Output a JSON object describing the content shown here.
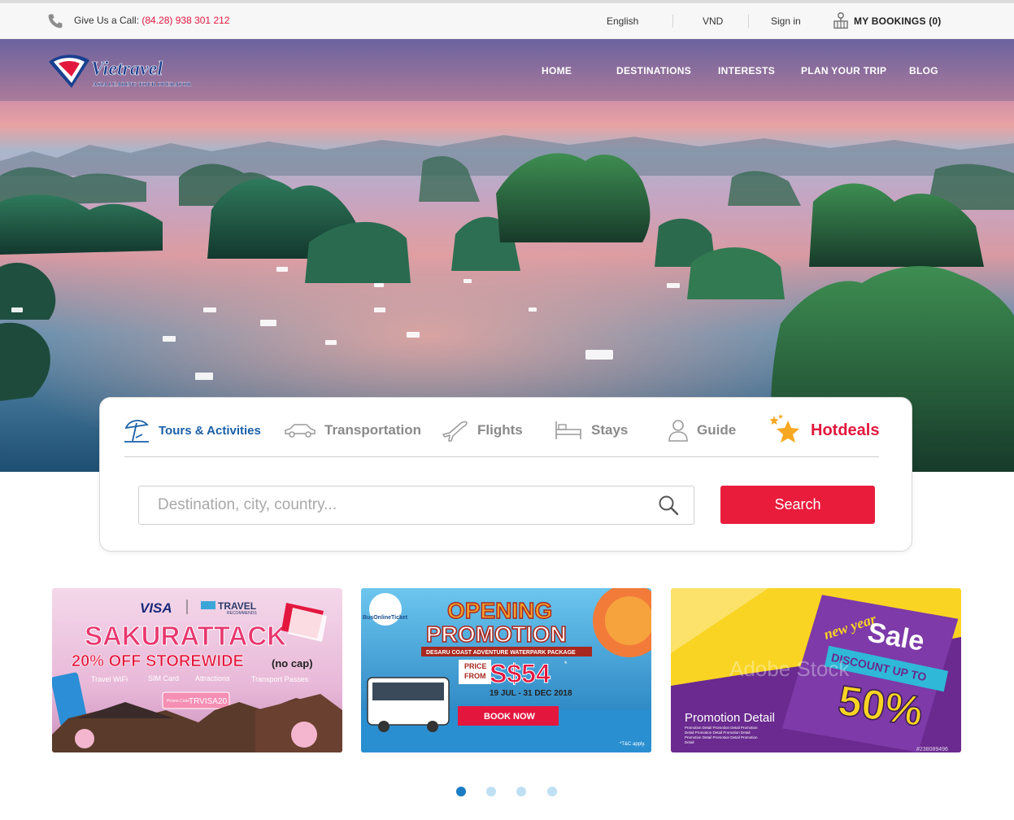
{
  "topbar": {
    "call_label": "Give Us a Call:",
    "phone": "(84.28) 938 301 212",
    "language": "English",
    "currency": "VND",
    "signin": "Sign in",
    "bookings": "MY BOOKINGS (0)"
  },
  "brand": {
    "name": "Vietravel",
    "tagline": "ASIA LEADING TOUR OPERATOR"
  },
  "nav": [
    "HOME",
    "DESTINATIONS",
    "INTERESTS",
    "PLAN YOUR TRIP",
    "BLOG"
  ],
  "search": {
    "tabs": [
      {
        "label": "Tours & Activities",
        "icon": "beach-umbrella-icon",
        "active": true
      },
      {
        "label": "Transportation",
        "icon": "car-icon"
      },
      {
        "label": "Flights",
        "icon": "airplane-icon"
      },
      {
        "label": "Stays",
        "icon": "bed-icon"
      },
      {
        "label": "Guide",
        "icon": "person-icon"
      },
      {
        "label": "Hotdeals",
        "icon": "star-icon"
      }
    ],
    "placeholder": "Destination, city, country...",
    "button": "Search"
  },
  "banners": [
    {
      "brand1": "VISA",
      "brand2": "TRAVEL",
      "brand2_sub": "RECOMMENDS",
      "headline": "SAKURATTACK",
      "subhead": "20% OFF STOREWIDE",
      "subhead_note": "(no cap)",
      "features": [
        "Travel WiFi",
        "SIM Card",
        "Attractions",
        "Transport Passes"
      ],
      "promo_label": "Promo Code",
      "promo_code": "TRVISA20"
    },
    {
      "logo_text": "BusOnlineTicket",
      "headline1": "OPENING",
      "headline2": "PROMOTION",
      "package": "DESARU COAST ADVENTURE WATERPARK PACKAGE",
      "price_label1": "PRICE",
      "price_label2": "FROM",
      "price": "S$54",
      "price_mark": "*",
      "dates": "19 JUL - 31 DEC 2018",
      "cta": "BOOK NOW",
      "terms": "*T&C apply."
    },
    {
      "script": "new year",
      "sale": "Sale",
      "discount": "DISCOUNT UP TO",
      "percent": "50%",
      "title": "Promotion Detail",
      "detail_lines": [
        "Promotion Detail  Promotion Detail  Promotion",
        "Detail  Promotion Detail  Promotion Detail",
        "Promotion Detail  Promotion Detail  Promotion",
        "Detail"
      ],
      "watermark": "Adobe Stock",
      "stock_id": "#238089496"
    }
  ],
  "carousel": {
    "total": 4,
    "active": 1
  },
  "colors": {
    "accent_red": "#ea1c3c",
    "link_blue": "#1a5fa8",
    "dot_active": "#1a7cc4",
    "dot_inactive": "#bfe0f3"
  }
}
